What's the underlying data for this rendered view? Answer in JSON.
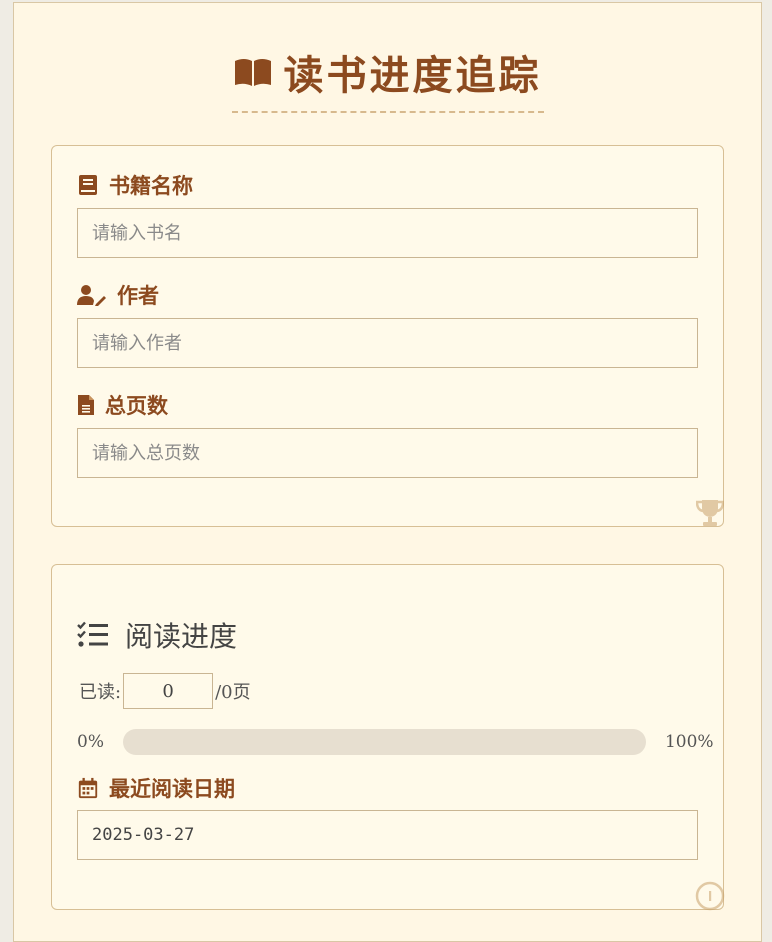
{
  "header": {
    "title": "读书进度追踪",
    "icon": "book-open-icon"
  },
  "form": {
    "book_name": {
      "label": "书籍名称",
      "placeholder": "请输入书名",
      "value": "",
      "icon": "book-icon"
    },
    "author": {
      "label": "作者",
      "placeholder": "请输入作者",
      "value": "",
      "icon": "user-pen-icon"
    },
    "total_pages": {
      "label": "总页数",
      "placeholder": "请输入总页数",
      "value": "",
      "icon": "file-icon"
    }
  },
  "progress": {
    "title": "阅读进度",
    "icon": "list-check-icon",
    "read_label": "已读:",
    "read_value": "0",
    "total_suffix": "/0页",
    "min_label": "0%",
    "max_label": "100%",
    "percent": 0,
    "date": {
      "label": "最近阅读日期",
      "value": "2025-03-27",
      "icon": "calendar-icon"
    }
  },
  "colors": {
    "accent": "#8c4a1f",
    "background": "#fff7e4",
    "border": "#d7bf95",
    "track": "#e7dfd0"
  }
}
